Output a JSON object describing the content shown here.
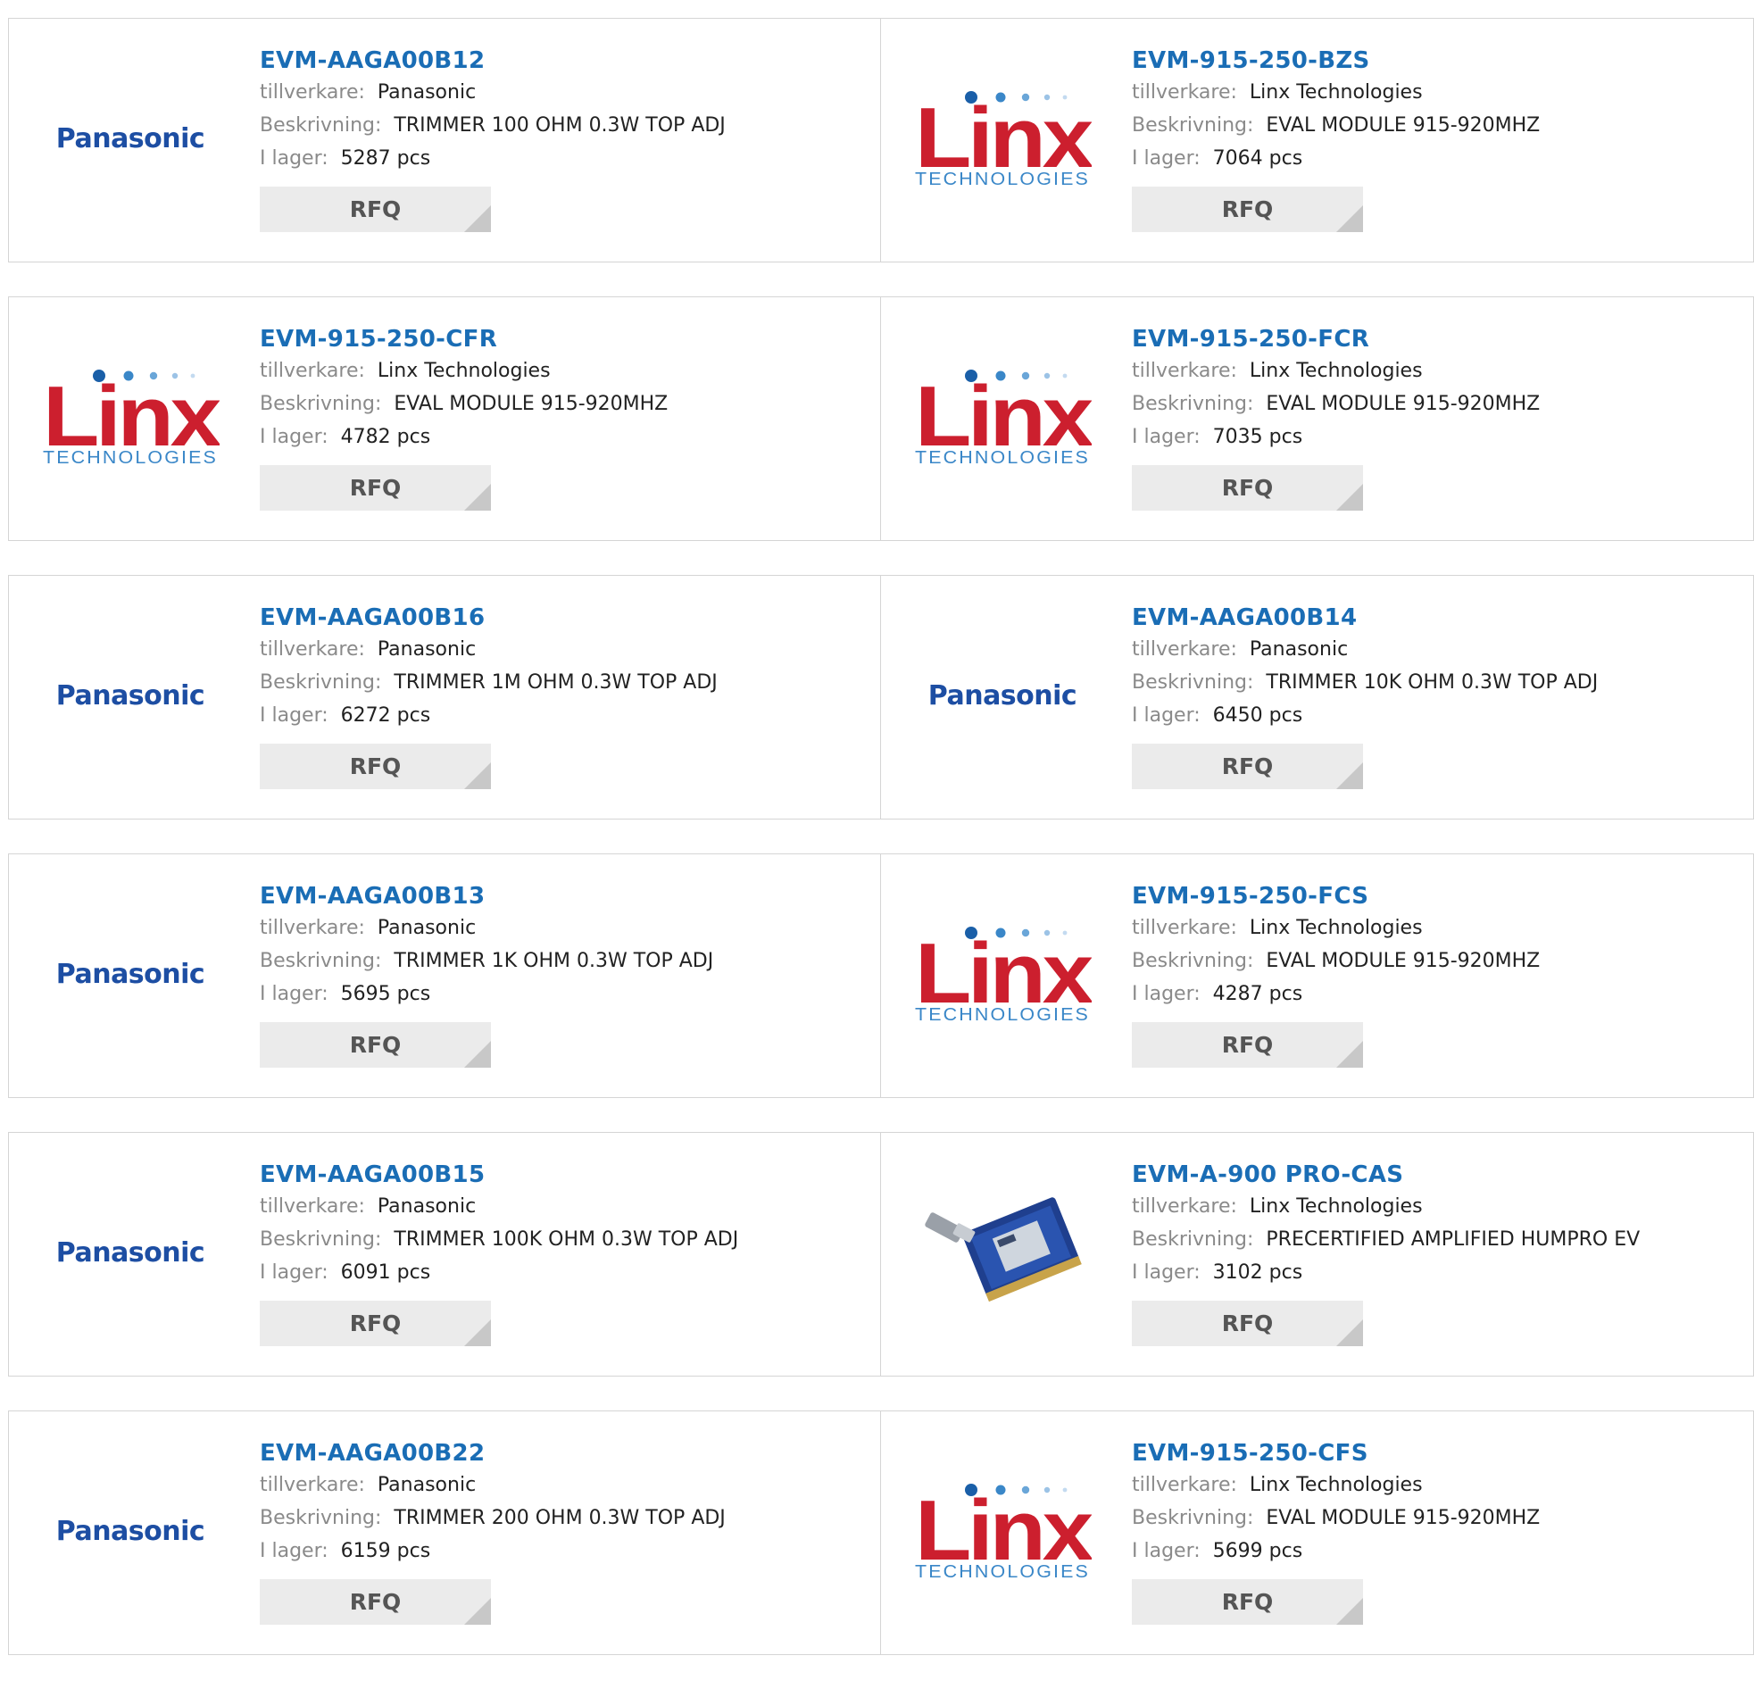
{
  "labels": {
    "manufacturer": "tillverkare:",
    "description": "Beskrivning:",
    "stock": "I lager:"
  },
  "colors": {
    "part_link": "#1a6db5",
    "panasonic_blue": "#1d4ea3",
    "linx_red": "#cc1f2e",
    "linx_blue": "#3a87c8",
    "rfq_bg": "#ebebeb"
  },
  "products": [
    {
      "part": "EVM-AAGA00B12",
      "manufacturer": "Panasonic",
      "logo": "panasonic-logo",
      "description": "TRIMMER 100 OHM 0.3W TOP ADJ",
      "stock": "5287 pcs",
      "rfq": "RFQ"
    },
    {
      "part": "EVM-915-250-BZS",
      "manufacturer": "Linx Technologies",
      "logo": "linx-logo",
      "description": "EVAL MODULE 915-920MHZ",
      "stock": "7064 pcs",
      "rfq": "RFQ"
    },
    {
      "part": "EVM-915-250-CFR",
      "manufacturer": "Linx Technologies",
      "logo": "linx-logo",
      "description": "EVAL MODULE 915-920MHZ",
      "stock": "4782 pcs",
      "rfq": "RFQ"
    },
    {
      "part": "EVM-915-250-FCR",
      "manufacturer": "Linx Technologies",
      "logo": "linx-logo",
      "description": "EVAL MODULE 915-920MHZ",
      "stock": "7035 pcs",
      "rfq": "RFQ"
    },
    {
      "part": "EVM-AAGA00B16",
      "manufacturer": "Panasonic",
      "logo": "panasonic-logo",
      "description": "TRIMMER 1M OHM 0.3W TOP ADJ",
      "stock": "6272 pcs",
      "rfq": "RFQ"
    },
    {
      "part": "EVM-AAGA00B14",
      "manufacturer": "Panasonic",
      "logo": "panasonic-logo",
      "description": "TRIMMER 10K OHM 0.3W TOP ADJ",
      "stock": "6450 pcs",
      "rfq": "RFQ"
    },
    {
      "part": "EVM-AAGA00B13",
      "manufacturer": "Panasonic",
      "logo": "panasonic-logo",
      "description": "TRIMMER 1K OHM 0.3W TOP ADJ",
      "stock": "5695 pcs",
      "rfq": "RFQ"
    },
    {
      "part": "EVM-915-250-FCS",
      "manufacturer": "Linx Technologies",
      "logo": "linx-logo",
      "description": "EVAL MODULE 915-920MHZ",
      "stock": "4287 pcs",
      "rfq": "RFQ"
    },
    {
      "part": "EVM-AAGA00B15",
      "manufacturer": "Panasonic",
      "logo": "panasonic-logo",
      "description": "TRIMMER 100K OHM 0.3W TOP ADJ",
      "stock": "6091 pcs",
      "rfq": "RFQ"
    },
    {
      "part": "EVM-A-900 PRO-CAS",
      "manufacturer": "Linx Technologies",
      "logo": "product-photo",
      "description": "PRECERTIFIED AMPLIFIED HUMPRO EV",
      "stock": "3102 pcs",
      "rfq": "RFQ"
    },
    {
      "part": "EVM-AAGA00B22",
      "manufacturer": "Panasonic",
      "logo": "panasonic-logo",
      "description": "TRIMMER 200 OHM 0.3W TOP ADJ",
      "stock": "6159 pcs",
      "rfq": "RFQ"
    },
    {
      "part": "EVM-915-250-CFS",
      "manufacturer": "Linx Technologies",
      "logo": "linx-logo",
      "description": "EVAL MODULE 915-920MHZ",
      "stock": "5699 pcs",
      "rfq": "RFQ"
    }
  ]
}
